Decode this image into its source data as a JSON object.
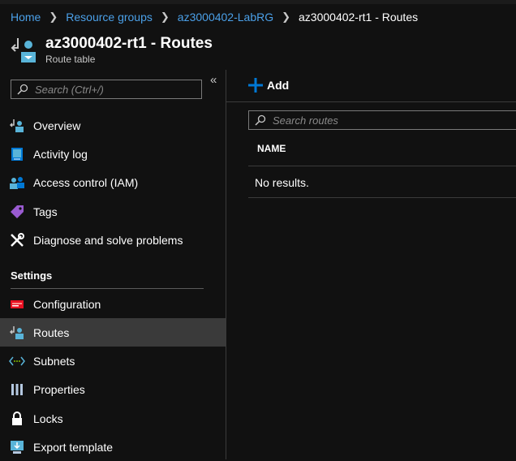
{
  "breadcrumb": {
    "items": [
      "Home",
      "Resource groups",
      "az3000402-LabRG"
    ],
    "current": "az3000402-rt1 - Routes"
  },
  "header": {
    "title": "az3000402-rt1 - Routes",
    "subtitle": "Route table",
    "icon": "route-table-icon"
  },
  "sidebar": {
    "search_placeholder": "Search (Ctrl+/)",
    "collapse_glyph": "«",
    "items": [
      {
        "label": "Overview",
        "icon": "route-table-icon"
      },
      {
        "label": "Activity log",
        "icon": "activity-log-icon"
      },
      {
        "label": "Access control (IAM)",
        "icon": "iam-icon"
      },
      {
        "label": "Tags",
        "icon": "tag-icon"
      },
      {
        "label": "Diagnose and solve problems",
        "icon": "wrench-icon"
      }
    ],
    "section": "Settings",
    "settings_items": [
      {
        "label": "Configuration",
        "icon": "configuration-icon"
      },
      {
        "label": "Routes",
        "icon": "route-table-icon",
        "active": true
      },
      {
        "label": "Subnets",
        "icon": "subnet-icon"
      },
      {
        "label": "Properties",
        "icon": "properties-icon"
      },
      {
        "label": "Locks",
        "icon": "lock-icon"
      },
      {
        "label": "Export template",
        "icon": "export-template-icon"
      }
    ]
  },
  "toolbar": {
    "add_label": "Add"
  },
  "main": {
    "search_placeholder": "Search routes",
    "column_header": "NAME",
    "empty_message": "No results."
  },
  "colors": {
    "background": "#111111",
    "link": "#4ba0e8",
    "active_item": "#3a3a3a",
    "accent": "#0078d4"
  }
}
